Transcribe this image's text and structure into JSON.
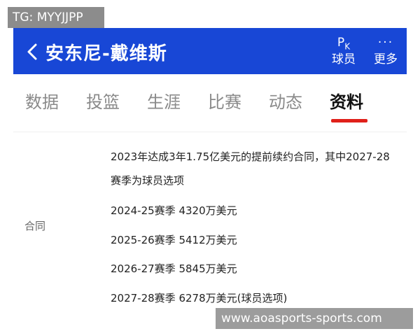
{
  "overlay": {
    "tg_label": "TG: MYYJJPP",
    "watermark": "www.aoasports-sports.com"
  },
  "header": {
    "title": "安东尼-戴维斯",
    "pk_label": "球员",
    "more_icon_text": "···",
    "more_label": "更多",
    "accent": "#1847d6"
  },
  "tabs": [
    "数据",
    "投篮",
    "生涯",
    "比赛",
    "动态",
    "资料"
  ],
  "active_tab": "资料",
  "tab_underline_color": "#e0201a",
  "contract": {
    "label": "合同",
    "summary_line1": "2023年达成3年1.75亿美元的提前续约合同，其中2027-28",
    "summary_line2": "赛季为球员选项",
    "seasons": [
      "2024-25赛季 4320万美元",
      "2025-26赛季 5412万美元",
      "2026-27赛季 5845万美元",
      "2027-28赛季 6278万美元(球员选项)"
    ]
  }
}
